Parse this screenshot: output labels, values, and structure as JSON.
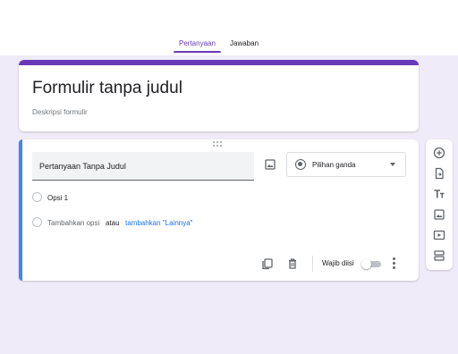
{
  "tabs": [
    {
      "label": "Pertanyaan",
      "active": true
    },
    {
      "label": "Jawaban",
      "active": false
    }
  ],
  "colors": {
    "accent": "#673ab7",
    "question_accent": "#4285f4",
    "link": "#1a73e8",
    "background": "#f0ebf8"
  },
  "form": {
    "title": "Formulir tanpa judul",
    "description_placeholder": "Deskripsi formulir"
  },
  "question": {
    "title": "Pertanyaan Tanpa Judul",
    "image_icon": "image-icon",
    "type_icon": "radio-button-icon",
    "type_label": "Pilihan ganda",
    "options": [
      {
        "label": "Opsi 1"
      }
    ],
    "add_option_label": "Tambahkan opsi",
    "or_label": "atau",
    "add_other_label": "tambahkan \"Lainnya\"",
    "footer_icons": [
      "copy-icon",
      "trash-icon",
      "more-vert-icon"
    ],
    "required_label": "Wajib diisi",
    "required": false
  },
  "side_toolbar": [
    "add-question-icon",
    "import-questions-icon",
    "add-title-icon",
    "add-image-icon",
    "add-video-icon",
    "add-section-icon"
  ]
}
